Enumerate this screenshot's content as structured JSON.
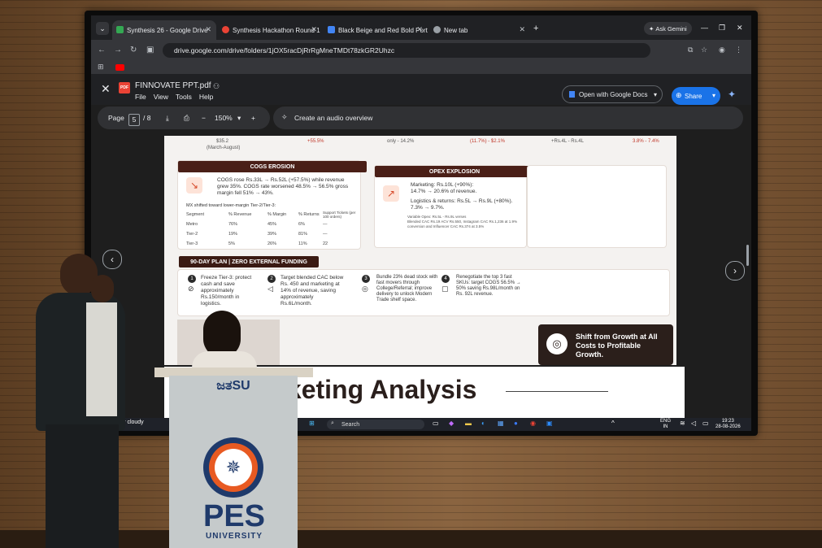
{
  "browser": {
    "tabs": [
      {
        "label": "Synthesis 26 - Google Drive",
        "color": "#34a853"
      },
      {
        "label": "Synthesis Hackathon Round 1",
        "color": "#ea4335"
      },
      {
        "label": "Black Beige and Red Bold Portf",
        "color": "#4285f4"
      },
      {
        "label": "New tab",
        "color": "#9aa0a6"
      }
    ],
    "url": "drive.google.com/drive/folders/1jOX5racDjRrRgMneTMDt78zkGR2Uhzc",
    "ask_gemini": "Ask Gemini"
  },
  "viewer": {
    "file_name": "FINNOVATE PPT.pdf",
    "menu": [
      "File",
      "View",
      "Tools",
      "Help"
    ],
    "open_with": "Open with Google Docs",
    "share": "Share",
    "page_label": "Page",
    "page_current": "5",
    "page_total": "/ 8",
    "zoom": "150%",
    "audio_overview": "Create an audio overview"
  },
  "slide": {
    "top_row": [
      "$35.2",
      "(March-August)",
      "+55.5%",
      "only - 14.2%",
      "(11.7%) - $2.1%",
      "+Rs.4L - Rs.4L",
      "3.8% - 7.4%"
    ],
    "cogs": {
      "title": "COGS EROSION",
      "text": "COGS rose Rs.33L → Rs.52L (+57.5%) while revenue grew 35%. COGS rate worsened 48.5% → 56.5% gross margin fell 51% → 43%.",
      "mix": "MX shifted toward lower-margin Tier-2/Tier-3:",
      "headers": [
        "Segment",
        "% Revenue",
        "% Margin",
        "% Returns",
        "Support Tickets (per 100 orders)"
      ],
      "rows": [
        [
          "Metro",
          "76%",
          "45%",
          "6%",
          "—"
        ],
        [
          "Tier-2",
          "19%",
          "39%",
          "81%",
          "—"
        ],
        [
          "Tier-3",
          "5%",
          "26%",
          "11%",
          "22"
        ]
      ]
    },
    "opex": {
      "title": "OPEX EXPLOSION",
      "lines": [
        "Marketing: Rs.10L (+90%):",
        "14.7% → 20.6% of revenue.",
        "Logistics & returns: Rs.5L → Rs.9L (+80%).",
        "7.3% → 9.7%."
      ],
      "fine": [
        "Variable Opex: Rs.5L - Rs.9L verses",
        "Blended CAC Rs.19 ACV Rs.550, Instagram CAC Rs.1,236 at 1.9% conversion and Influencer CAC Rs.374 at 3.5%"
      ]
    },
    "plan": {
      "title": "90-DAY PLAN | ZERO EXTERNAL FUNDING",
      "steps": [
        {
          "num": "1",
          "text": "Freeze Tier-3: protect cash and save approximately Rs.150/month in logistics."
        },
        {
          "num": "2",
          "text": "Target blended CAC below Rs. 450 and marketing at 14% of revenue, saving approximately Rs.6L/month."
        },
        {
          "num": "3",
          "text": "Bundle 23% dead stock with fast movers through College/Referral; improve delivery to unlock Modern Trade shelf space."
        },
        {
          "num": "4",
          "text": "Renegotiate the top 3 fast SKUs: target COGS 56.5% → 50% saving Rs.98L/month on Rs. 92L revenue."
        }
      ]
    },
    "callout": "Shift from Growth at All Costs to Profitable Growth.",
    "next_title": "Marketing Analysis"
  },
  "taskbar": {
    "weather": "stly cloudy",
    "search": "Search",
    "lang": "ENG\nIN",
    "time": "19:23",
    "date": "28-08-2026"
  },
  "podium": {
    "brand": "ಜತSU",
    "name": "PES",
    "sub": "UNIVERSITY"
  }
}
